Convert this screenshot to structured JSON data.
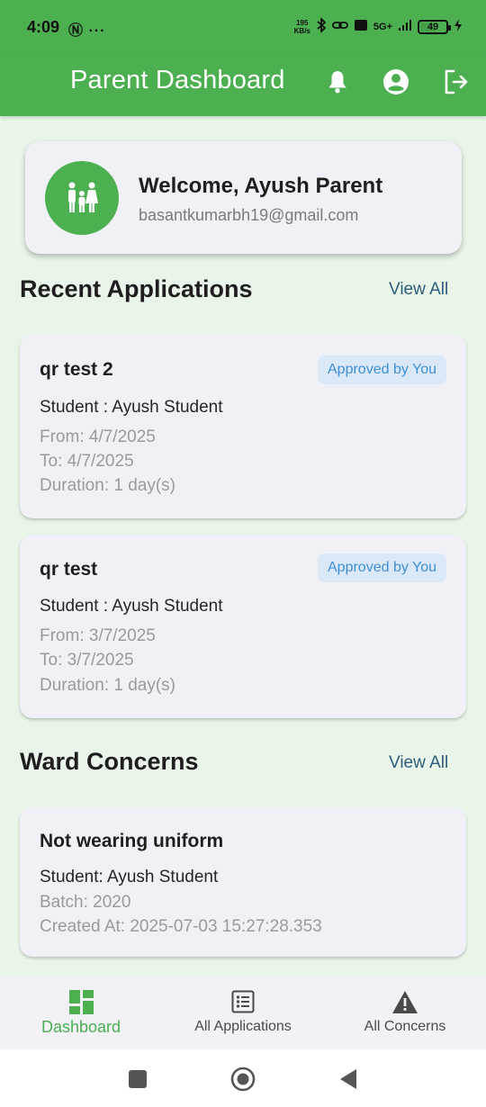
{
  "status_bar": {
    "time": "4:09",
    "left_icons": "Ⓝ ···",
    "net_speed_value": "195",
    "net_speed_unit": "KB/s",
    "network": "5G+",
    "battery": "49"
  },
  "app_bar": {
    "title": "Parent Dashboard",
    "icons": [
      "bell-icon",
      "account-circle-icon",
      "logout-icon"
    ]
  },
  "welcome": {
    "name": "Welcome, Ayush Parent",
    "email": "basantkumarbh19@gmail.com"
  },
  "recent_applications": {
    "title": "Recent Applications",
    "view_all": "View All",
    "items": [
      {
        "title": "qr test 2",
        "status": "Approved by You",
        "student": "Student : Ayush Student",
        "from": "From: 4/7/2025",
        "to": "To: 4/7/2025",
        "duration": "Duration: 1 day(s)"
      },
      {
        "title": "qr test",
        "status": "Approved by You",
        "student": "Student : Ayush Student",
        "from": "From: 3/7/2025",
        "to": "To: 3/7/2025",
        "duration": "Duration: 1 day(s)"
      }
    ]
  },
  "ward_concerns": {
    "title": "Ward Concerns",
    "view_all": "View All",
    "items": [
      {
        "title": "Not wearing uniform",
        "student": "Student: Ayush Student",
        "batch": "Batch: 2020",
        "created_at": "Created At: 2025-07-03 15:27:28.353"
      }
    ]
  },
  "bottom_nav": {
    "items": [
      {
        "label": "Dashboard",
        "icon": "dashboard-icon",
        "active": true
      },
      {
        "label": "All Applications",
        "icon": "list-icon",
        "active": false
      },
      {
        "label": "All Concerns",
        "icon": "warning-icon",
        "active": false
      }
    ]
  },
  "colors": {
    "primary": "#4caf50",
    "background": "#e8f5e8",
    "card": "#f0f0f7",
    "badge_bg": "#dbe8f7",
    "badge_text": "#3f8fd8",
    "link": "#2e5d7a"
  }
}
